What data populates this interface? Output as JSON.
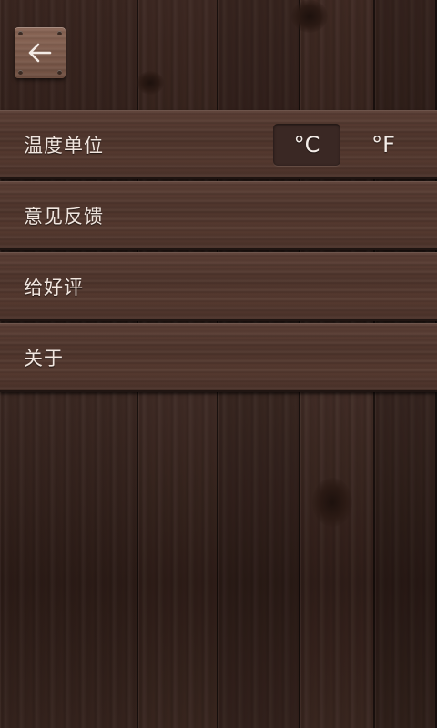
{
  "header": {
    "back_icon": "arrow-left-icon"
  },
  "menu": {
    "temperature_unit": {
      "label": "温度单位",
      "options": [
        "°C",
        "°F"
      ],
      "selected": "°C"
    },
    "feedback": {
      "label": "意见反馈"
    },
    "rate": {
      "label": "给好评"
    },
    "about": {
      "label": "关于"
    }
  },
  "colors": {
    "plank": "#553a30",
    "back_button": "#7a5a4a",
    "selected_unit_bg": "#3a2824",
    "text": "#f1e6df"
  }
}
